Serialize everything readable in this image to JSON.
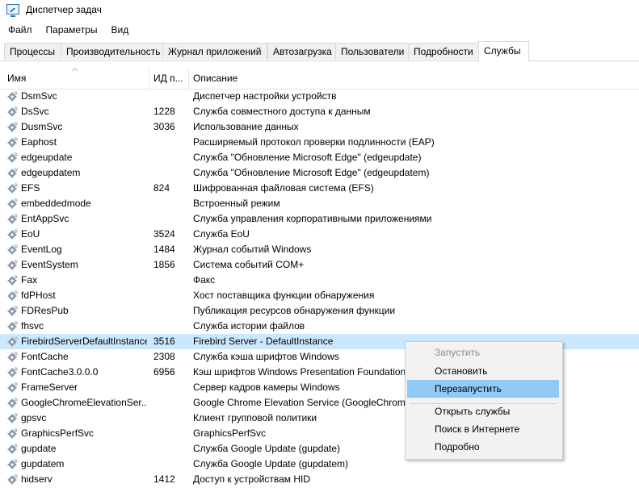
{
  "window": {
    "title": "Диспетчер задач"
  },
  "menu": [
    "Файл",
    "Параметры",
    "Вид"
  ],
  "tabs": [
    "Процессы",
    "Производительность",
    "Журнал приложений",
    "Автозагрузка",
    "Пользователи",
    "Подробности",
    "Службы"
  ],
  "active_tab": "Службы",
  "columns": {
    "name": "Имя",
    "pid": "ИД п...",
    "desc": "Описание"
  },
  "services": [
    {
      "name": "DsmSvc",
      "pid": "",
      "desc": "Диспетчер настройки устройств"
    },
    {
      "name": "DsSvc",
      "pid": "1228",
      "desc": "Служба совместного доступа к данным"
    },
    {
      "name": "DusmSvc",
      "pid": "3036",
      "desc": "Использование данных"
    },
    {
      "name": "Eaphost",
      "pid": "",
      "desc": "Расширяемый протокол проверки подлинности (EAP)"
    },
    {
      "name": "edgeupdate",
      "pid": "",
      "desc": "Служба \"Обновление Microsoft Edge\" (edgeupdate)"
    },
    {
      "name": "edgeupdatem",
      "pid": "",
      "desc": "Служба \"Обновление Microsoft Edge\" (edgeupdatem)"
    },
    {
      "name": "EFS",
      "pid": "824",
      "desc": "Шифрованная файловая система (EFS)"
    },
    {
      "name": "embeddedmode",
      "pid": "",
      "desc": "Встроенный режим"
    },
    {
      "name": "EntAppSvc",
      "pid": "",
      "desc": "Служба управления корпоративными приложениями"
    },
    {
      "name": "EoU",
      "pid": "3524",
      "desc": "Служба EoU"
    },
    {
      "name": "EventLog",
      "pid": "1484",
      "desc": "Журнал событий Windows"
    },
    {
      "name": "EventSystem",
      "pid": "1856",
      "desc": "Система событий COM+"
    },
    {
      "name": "Fax",
      "pid": "",
      "desc": "Факс"
    },
    {
      "name": "fdPHost",
      "pid": "",
      "desc": "Хост поставщика функции обнаружения"
    },
    {
      "name": "FDResPub",
      "pid": "",
      "desc": "Публикация ресурсов обнаружения функции"
    },
    {
      "name": "fhsvc",
      "pid": "",
      "desc": "Служба истории файлов"
    },
    {
      "name": "FirebirdServerDefaultInstance",
      "pid": "3516",
      "desc": "Firebird Server - DefaultInstance",
      "selected": true
    },
    {
      "name": "FontCache",
      "pid": "2308",
      "desc": "Служба кэша шрифтов Windows"
    },
    {
      "name": "FontCache3.0.0.0",
      "pid": "6956",
      "desc": "Кэш шрифтов Windows Presentation Foundation"
    },
    {
      "name": "FrameServer",
      "pid": "",
      "desc": "Сервер кадров камеры Windows"
    },
    {
      "name": "GoogleChromeElevationSer...",
      "pid": "",
      "desc": "Google Chrome Elevation Service (GoogleChrome"
    },
    {
      "name": "gpsvc",
      "pid": "",
      "desc": "Клиент групповой политики"
    },
    {
      "name": "GraphicsPerfSvc",
      "pid": "",
      "desc": "GraphicsPerfSvc"
    },
    {
      "name": "gupdate",
      "pid": "",
      "desc": "Служба Google Update (gupdate)"
    },
    {
      "name": "gupdatem",
      "pid": "",
      "desc": "Служба Google Update (gupdatem)"
    },
    {
      "name": "hidserv",
      "pid": "1412",
      "desc": "Доступ к устройствам HID"
    }
  ],
  "context_menu": {
    "start": "Запустить",
    "stop": "Остановить",
    "restart": "Перезапустить",
    "open_services": "Открыть службы",
    "search_online": "Поиск в Интернете",
    "details": "Подробно"
  },
  "colors": {
    "selection": "#cce8ff",
    "menu_highlight": "#91c9f7"
  }
}
